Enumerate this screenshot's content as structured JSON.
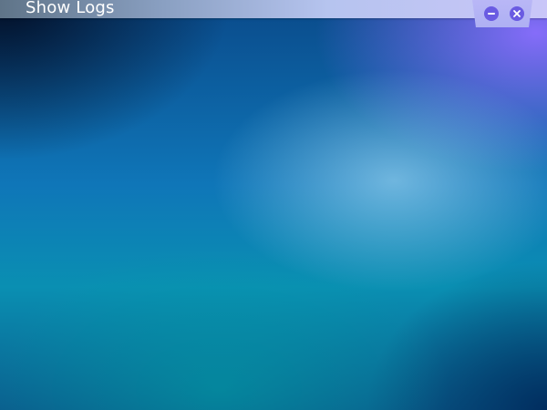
{
  "window": {
    "title": "Show Logs"
  },
  "controls": {
    "minimize_icon": "minus-icon",
    "close_icon": "close-icon"
  },
  "colors": {
    "control_button": "#6a5be2",
    "title_text": "#ffffff"
  }
}
